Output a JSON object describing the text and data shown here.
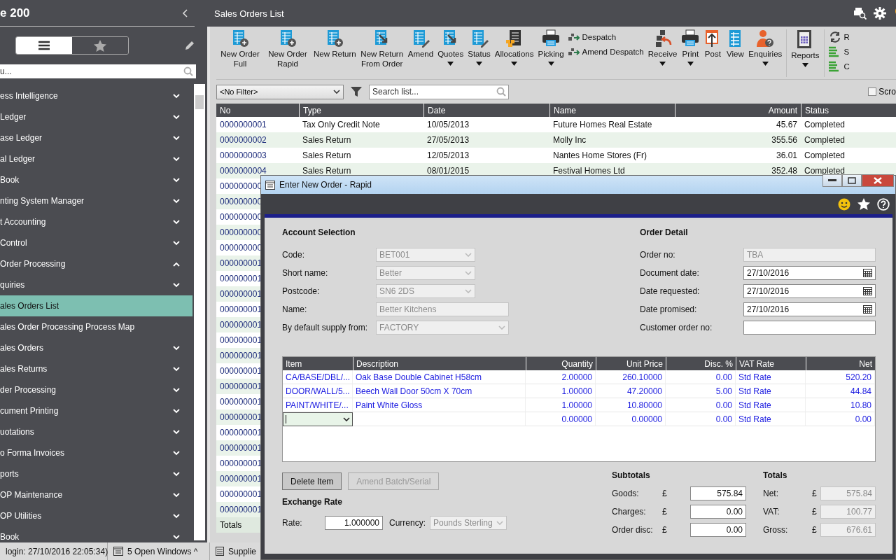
{
  "sidebar": {
    "title": "e 200",
    "view_toggle": [
      {
        "selected": true
      },
      {
        "selected": false
      }
    ],
    "search": {
      "placeholder": "u..."
    },
    "menu": [
      {
        "label": "ess Intelligence",
        "expanded": false,
        "selected": false
      },
      {
        "label": "Ledger",
        "expanded": false,
        "selected": false
      },
      {
        "label": "ase Ledger",
        "expanded": false,
        "selected": false
      },
      {
        "label": "al Ledger",
        "expanded": false,
        "selected": false
      },
      {
        "label": "Book",
        "expanded": false,
        "selected": false
      },
      {
        "label": "nting System Manager",
        "expanded": false,
        "selected": false
      },
      {
        "label": "t Accounting",
        "expanded": false,
        "selected": false
      },
      {
        "label": "Control",
        "expanded": false,
        "selected": false
      },
      {
        "label": "Order Processing",
        "expanded": true,
        "selected": false,
        "children": [
          {
            "label": "quiries",
            "expanded": false,
            "selected": false
          },
          {
            "label": "ales Orders List",
            "selected": true
          },
          {
            "label": "ales Order Processing Process Map",
            "selected": false
          },
          {
            "label": "ales Orders",
            "expanded": false,
            "selected": false
          },
          {
            "label": "ales Returns",
            "expanded": false,
            "selected": false
          },
          {
            "label": "der Processing",
            "expanded": false,
            "selected": false
          },
          {
            "label": "cument Printing",
            "expanded": false,
            "selected": false
          },
          {
            "label": "uotations",
            "expanded": false,
            "selected": false
          },
          {
            "label": "o Forma Invoices",
            "expanded": false,
            "selected": false
          },
          {
            "label": "ports",
            "expanded": false,
            "selected": false
          },
          {
            "label": "OP Maintenance",
            "expanded": false,
            "selected": false
          },
          {
            "label": "OP Utilities",
            "expanded": false,
            "selected": false
          }
        ]
      },
      {
        "label": "Book",
        "expanded": false,
        "selected": false
      }
    ]
  },
  "main": {
    "title": "Sales Orders List",
    "toolbar": [
      {
        "items": [
          {
            "kind": "large",
            "label": "New Order Full",
            "dropdown": false
          },
          {
            "kind": "large",
            "label": "New Order Rapid",
            "dropdown": false
          },
          {
            "kind": "large",
            "label": "New Return",
            "dropdown": false
          },
          {
            "kind": "large",
            "label": "New Return From Order",
            "dropdown": false
          },
          {
            "kind": "large",
            "label": "Amend",
            "dropdown": false
          },
          {
            "kind": "large",
            "label": "Quotes",
            "dropdown": true
          },
          {
            "kind": "large",
            "label": "Status",
            "dropdown": true
          },
          {
            "kind": "large",
            "label": "Allocations",
            "dropdown": true
          },
          {
            "kind": "large",
            "label": "Picking",
            "dropdown": true
          },
          {
            "kind": "stack",
            "entries": [
              "Despatch",
              "Amend Despatch"
            ]
          },
          {
            "kind": "large",
            "label": "Receive",
            "dropdown": true
          },
          {
            "kind": "large",
            "label": "Print",
            "dropdown": true
          },
          {
            "kind": "large",
            "label": "Post",
            "dropdown": false
          },
          {
            "kind": "large",
            "label": "View",
            "dropdown": false
          },
          {
            "kind": "large",
            "label": "Enquiries",
            "dropdown": true
          }
        ]
      },
      {
        "items": [
          {
            "kind": "large",
            "label": "Reports",
            "dropdown": true
          }
        ]
      },
      {
        "items": [
          {
            "kind": "stack",
            "entries": [
              "R",
              "S",
              "C"
            ]
          }
        ]
      }
    ],
    "filter": {
      "value": "<No Filter>"
    },
    "search": {
      "placeholder": "Search list..."
    },
    "scroll_option": {
      "label": "Scro",
      "checked": false
    },
    "table": {
      "columns": [
        "No",
        "Type",
        "Date",
        "Name",
        "Amount",
        "Status"
      ],
      "rows": [
        {
          "cells": [
            "0000000001",
            "Tax Only Credit Note",
            "10/05/2013",
            "Future Homes Real Estate",
            "45.67",
            "Completed"
          ]
        },
        {
          "cells": [
            "0000000002",
            "Sales Return",
            "27/05/2013",
            "Molly Inc",
            "355.56",
            "Completed"
          ]
        },
        {
          "cells": [
            "0000000003",
            "Sales Return",
            "12/05/2013",
            "Nantes Home Stores (Fr)",
            "36.01",
            "Completed"
          ]
        },
        {
          "cells": [
            "0000000004",
            "Sales Return",
            "08/01/2015",
            "Festival Homes Ltd",
            "352.48",
            "Completed"
          ]
        },
        {
          "cells": [
            "000000000"
          ]
        },
        {
          "cells": [
            "000000000"
          ]
        },
        {
          "cells": [
            "000000000"
          ]
        },
        {
          "cells": [
            "000000000"
          ]
        },
        {
          "cells": [
            "000000000"
          ]
        },
        {
          "cells": [
            "000000001"
          ]
        },
        {
          "cells": [
            "000000001"
          ]
        },
        {
          "cells": [
            "000000001"
          ]
        },
        {
          "cells": [
            "000000001"
          ]
        },
        {
          "cells": [
            "000000001"
          ]
        },
        {
          "cells": [
            "000000001"
          ]
        },
        {
          "cells": [
            "000000001"
          ]
        },
        {
          "cells": [
            "000000001"
          ]
        },
        {
          "cells": [
            "000000001"
          ]
        },
        {
          "cells": [
            "000000001"
          ]
        },
        {
          "cells": [
            "000000001"
          ]
        },
        {
          "cells": [
            "000000001"
          ]
        },
        {
          "cells": [
            "000000001"
          ]
        },
        {
          "cells": [
            "000000001"
          ]
        },
        {
          "cells": [
            "000000001"
          ]
        },
        {
          "cells": [
            "000000001"
          ]
        },
        {
          "cells": [
            "000000001"
          ]
        }
      ],
      "totals_label": "Totals"
    }
  },
  "status_bar": {
    "login": "login: 27/10/2016 22:05:34)",
    "windows": "5 Open Windows ^",
    "tab": "Supplie"
  },
  "dialog": {
    "title": "Enter New Order - Rapid",
    "account": {
      "heading": "Account Selection",
      "fields": [
        {
          "label": "Code:",
          "value": "BET001",
          "kind": "combo",
          "disabled": true
        },
        {
          "label": "Short name:",
          "value": "Better",
          "kind": "combo",
          "disabled": true
        },
        {
          "label": "Postcode:",
          "value": "SN6 2DS",
          "kind": "combo",
          "disabled": true
        },
        {
          "label": "Name:",
          "value": "Better Kitchens",
          "kind": "text",
          "disabled": true
        },
        {
          "label": "By default supply from:",
          "value": "FACTORY",
          "kind": "combo",
          "disabled": true
        }
      ]
    },
    "order": {
      "heading": "Order Detail",
      "fields": [
        {
          "label": "Order no:",
          "value": "TBA",
          "kind": "text",
          "disabled": true
        },
        {
          "label": "Document date:",
          "value": "27/10/2016",
          "kind": "date",
          "disabled": false
        },
        {
          "label": "Date requested:",
          "value": "27/10/2016",
          "kind": "date",
          "disabled": false
        },
        {
          "label": "Date promised:",
          "value": "27/10/2016",
          "kind": "date",
          "disabled": false
        },
        {
          "label": "Customer order no:",
          "kind": "text",
          "disabled": false
        }
      ]
    },
    "lines": {
      "columns": [
        "Item",
        "Description",
        "Quantity",
        "Unit Price",
        "Disc. %",
        "VAT Rate",
        "Net"
      ],
      "rows": [
        {
          "kind": "line",
          "cells": [
            "CA/BASE/DBL/...",
            "Oak Base Double Cabinet H58cm",
            "2.00000",
            "260.10000",
            "0.00",
            "Std Rate",
            "520.20"
          ]
        },
        {
          "kind": "line",
          "cells": [
            "DOOR/WALL/5...",
            "Beech Wall Door 50cm X 70cm",
            "1.00000",
            "47.20000",
            "5.00",
            "Std Rate",
            "44.84"
          ]
        },
        {
          "kind": "line",
          "cells": [
            "PAINT/WHITE/...",
            "Paint White Gloss",
            "1.00000",
            "10.80000",
            "0.00",
            "Std Rate",
            "10.80"
          ]
        },
        {
          "kind": "entry",
          "cells": [
            null,
            null,
            "0.00000",
            "0.00000",
            "0.00",
            "Std Rate",
            "0.00"
          ]
        }
      ]
    },
    "buttons": [
      {
        "label": "Delete Item",
        "disabled": false
      },
      {
        "label": "Amend Batch/Serial",
        "disabled": true
      }
    ],
    "exchange": {
      "heading": "Exchange Rate",
      "rate_label": "Rate:",
      "rate": "1.000000",
      "currency_label": "Currency:",
      "currency": "Pounds Sterling",
      "currency_disabled": true
    },
    "subtotals": {
      "heading": "Subtotals",
      "rows": [
        {
          "label": "Goods:",
          "currency": "£",
          "value": "575.84",
          "disabled": false
        },
        {
          "label": "Charges:",
          "currency": "£",
          "value": "0.00",
          "disabled": false
        },
        {
          "label": "Order disc:",
          "currency": "£",
          "value": "0.00",
          "disabled": false
        }
      ]
    },
    "totals": {
      "heading": "Totals",
      "rows": [
        {
          "label": "Net:",
          "currency": "£",
          "value": "575.84",
          "disabled": true
        },
        {
          "label": "VAT:",
          "currency": "£",
          "value": "100.77",
          "disabled": true
        },
        {
          "label": "Gross:",
          "currency": "£",
          "value": "676.61",
          "disabled": true
        }
      ]
    }
  }
}
